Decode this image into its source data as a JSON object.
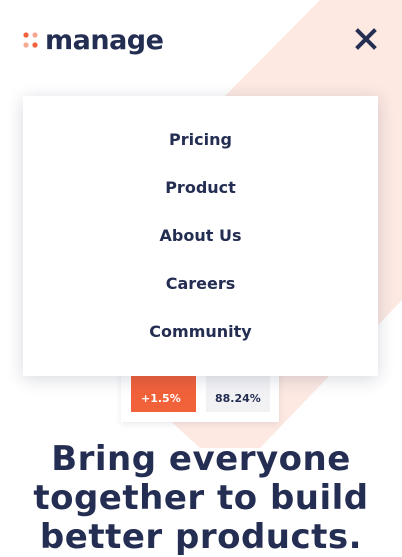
{
  "brand": {
    "name": "manage",
    "accent_color": "#f1613a",
    "text_color": "#242d52",
    "soft_bg_color": "#fde8e2"
  },
  "header": {
    "close_icon": "close-icon"
  },
  "menu": {
    "items": [
      {
        "label": "Pricing"
      },
      {
        "label": "Product"
      },
      {
        "label": "About Us"
      },
      {
        "label": "Careers"
      },
      {
        "label": "Community"
      }
    ]
  },
  "stats": {
    "left_value": "+1.5%",
    "right_value": "88.24%"
  },
  "hero": {
    "headline": "Bring everyone together to build better products."
  }
}
